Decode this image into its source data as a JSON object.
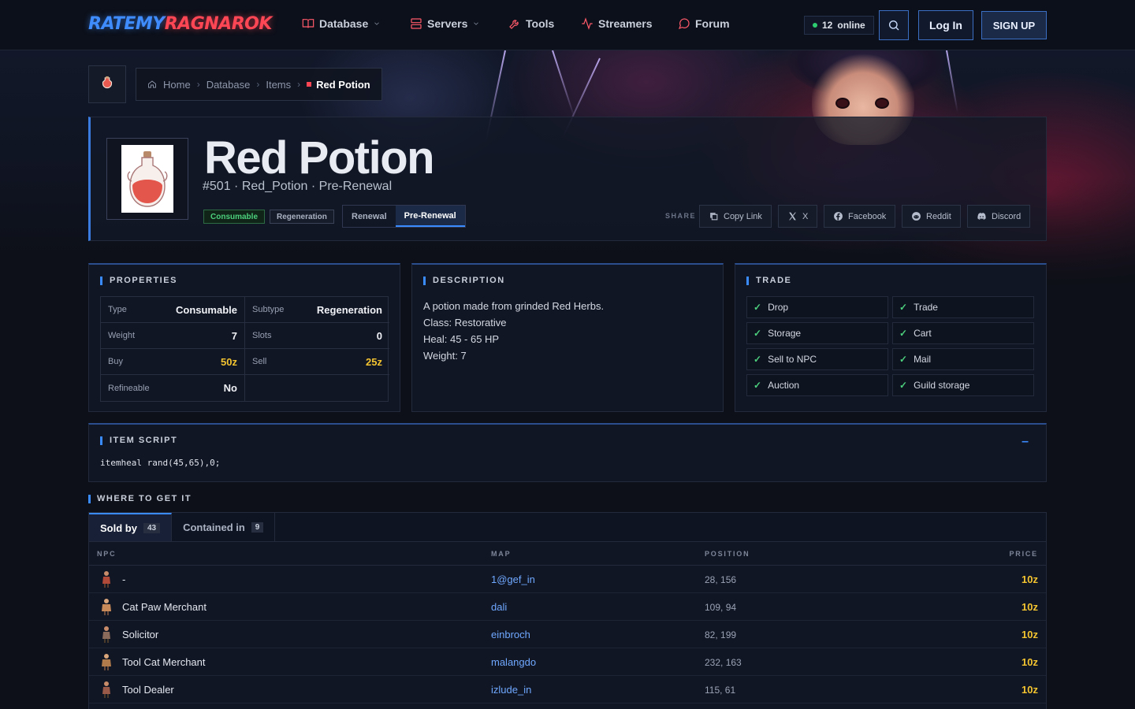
{
  "header": {
    "logo_part1": "RATEMY",
    "logo_part2": "RAGNAROK",
    "nav": [
      {
        "label": "Database",
        "icon": "book-icon",
        "dropdown": true
      },
      {
        "label": "Servers",
        "icon": "server-icon",
        "dropdown": true
      },
      {
        "label": "Tools",
        "icon": "wrench-icon",
        "dropdown": false
      },
      {
        "label": "Streamers",
        "icon": "activity-icon",
        "dropdown": false
      },
      {
        "label": "Forum",
        "icon": "chat-icon",
        "dropdown": false
      }
    ],
    "online_count": "12",
    "online_label": "online",
    "login_label": "Log In",
    "signup_label": "SIGN UP"
  },
  "breadcrumb": [
    "Home",
    "Database",
    "Items",
    "Red Potion"
  ],
  "item": {
    "name": "Red Potion",
    "subtitle": "#501 · Red_Potion · Pre-Renewal",
    "tags": [
      "Consumable",
      "Regeneration"
    ],
    "versions": [
      "Renewal",
      "Pre-Renewal"
    ],
    "active_version": "Pre-Renewal",
    "share_label": "SHARE",
    "share_buttons": [
      "Copy Link",
      "X",
      "Facebook",
      "Reddit",
      "Discord"
    ]
  },
  "properties": {
    "title": "PROPERTIES",
    "rows": [
      {
        "label": "Type",
        "value": "Consumable"
      },
      {
        "label": "Subtype",
        "value": "Regeneration"
      },
      {
        "label": "Weight",
        "value": "7"
      },
      {
        "label": "Slots",
        "value": "0"
      },
      {
        "label": "Buy",
        "value": "50z"
      },
      {
        "label": "Sell",
        "value": "25z"
      },
      {
        "label": "Refineable",
        "value": "No"
      }
    ]
  },
  "description": {
    "title": "DESCRIPTION",
    "lines": [
      "A potion made from grinded Red Herbs.",
      "Class: Restorative",
      "Heal: 45 - 65 HP",
      "Weight: 7"
    ]
  },
  "trade": {
    "title": "TRADE",
    "items": [
      "Drop",
      "Trade",
      "Storage",
      "Cart",
      "Sell to NPC",
      "Mail",
      "Auction",
      "Guild storage"
    ]
  },
  "script": {
    "title": "ITEM SCRIPT",
    "code": "itemheal rand(45,65),0;",
    "collapse": "–"
  },
  "where": {
    "title": "WHERE TO GET IT",
    "tabs": [
      {
        "label": "Sold by",
        "count": "43"
      },
      {
        "label": "Contained in",
        "count": "9"
      }
    ],
    "columns": [
      "NPC",
      "MAP",
      "POSITION",
      "PRICE"
    ],
    "rows": [
      {
        "npc": "-",
        "map": "1@gef_in",
        "pos": "28, 156",
        "price": "10z"
      },
      {
        "npc": "Cat Paw Merchant",
        "map": "dali",
        "pos": "109, 94",
        "price": "10z"
      },
      {
        "npc": "Solicitor",
        "map": "einbroch",
        "pos": "82, 199",
        "price": "10z"
      },
      {
        "npc": "Tool Cat Merchant",
        "map": "malangdo",
        "pos": "232, 163",
        "price": "10z"
      },
      {
        "npc": "Tool Dealer",
        "map": "izlude_in",
        "pos": "115, 61",
        "price": "10z"
      }
    ]
  },
  "colors": {
    "accent": "#3a8bff",
    "brand_red": "#ff4655",
    "gold": "#f4c430",
    "success": "#4cd07d"
  }
}
